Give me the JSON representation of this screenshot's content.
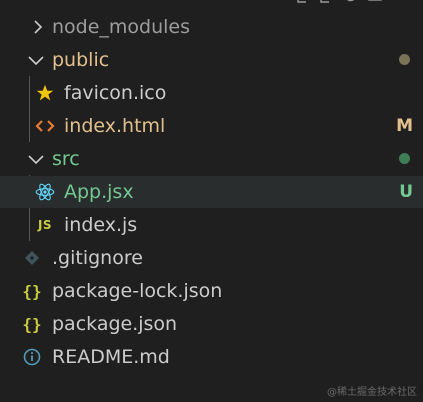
{
  "colors": {
    "background": "#1f1f1f",
    "text": "#cccccc",
    "modified": "#e2c08d",
    "untracked": "#73c991",
    "folder_dot_public": "#7a7358",
    "folder_dot_src": "#3f7d55",
    "react": "#61dafb",
    "json": "#cbcb41",
    "html": "#e37933",
    "star": "#f1c40f",
    "readme": "#519aba"
  },
  "tree": {
    "node_modules": {
      "label": "node_modules",
      "icon": "chevron-right-icon"
    },
    "public": {
      "label": "public",
      "icon": "chevron-down-icon"
    },
    "favicon": {
      "label": "favicon.ico",
      "icon": "star-icon"
    },
    "index_html": {
      "label": "index.html",
      "icon": "html-icon",
      "status": "M"
    },
    "src": {
      "label": "src",
      "icon": "chevron-down-icon"
    },
    "app_jsx": {
      "label": "App.jsx",
      "icon": "react-icon",
      "status": "U"
    },
    "index_js": {
      "label": "index.js",
      "icon": "js-icon",
      "icon_text": "JS"
    },
    "gitignore": {
      "label": ".gitignore",
      "icon": "git-icon"
    },
    "package_lock": {
      "label": "package-lock.json",
      "icon": "json-icon",
      "icon_text": "{}"
    },
    "package_json": {
      "label": "package.json",
      "icon": "json-icon",
      "icon_text": "{}"
    },
    "readme": {
      "label": "README.md",
      "icon": "info-icon"
    }
  },
  "watermark": "@稀土掘金技术社区"
}
